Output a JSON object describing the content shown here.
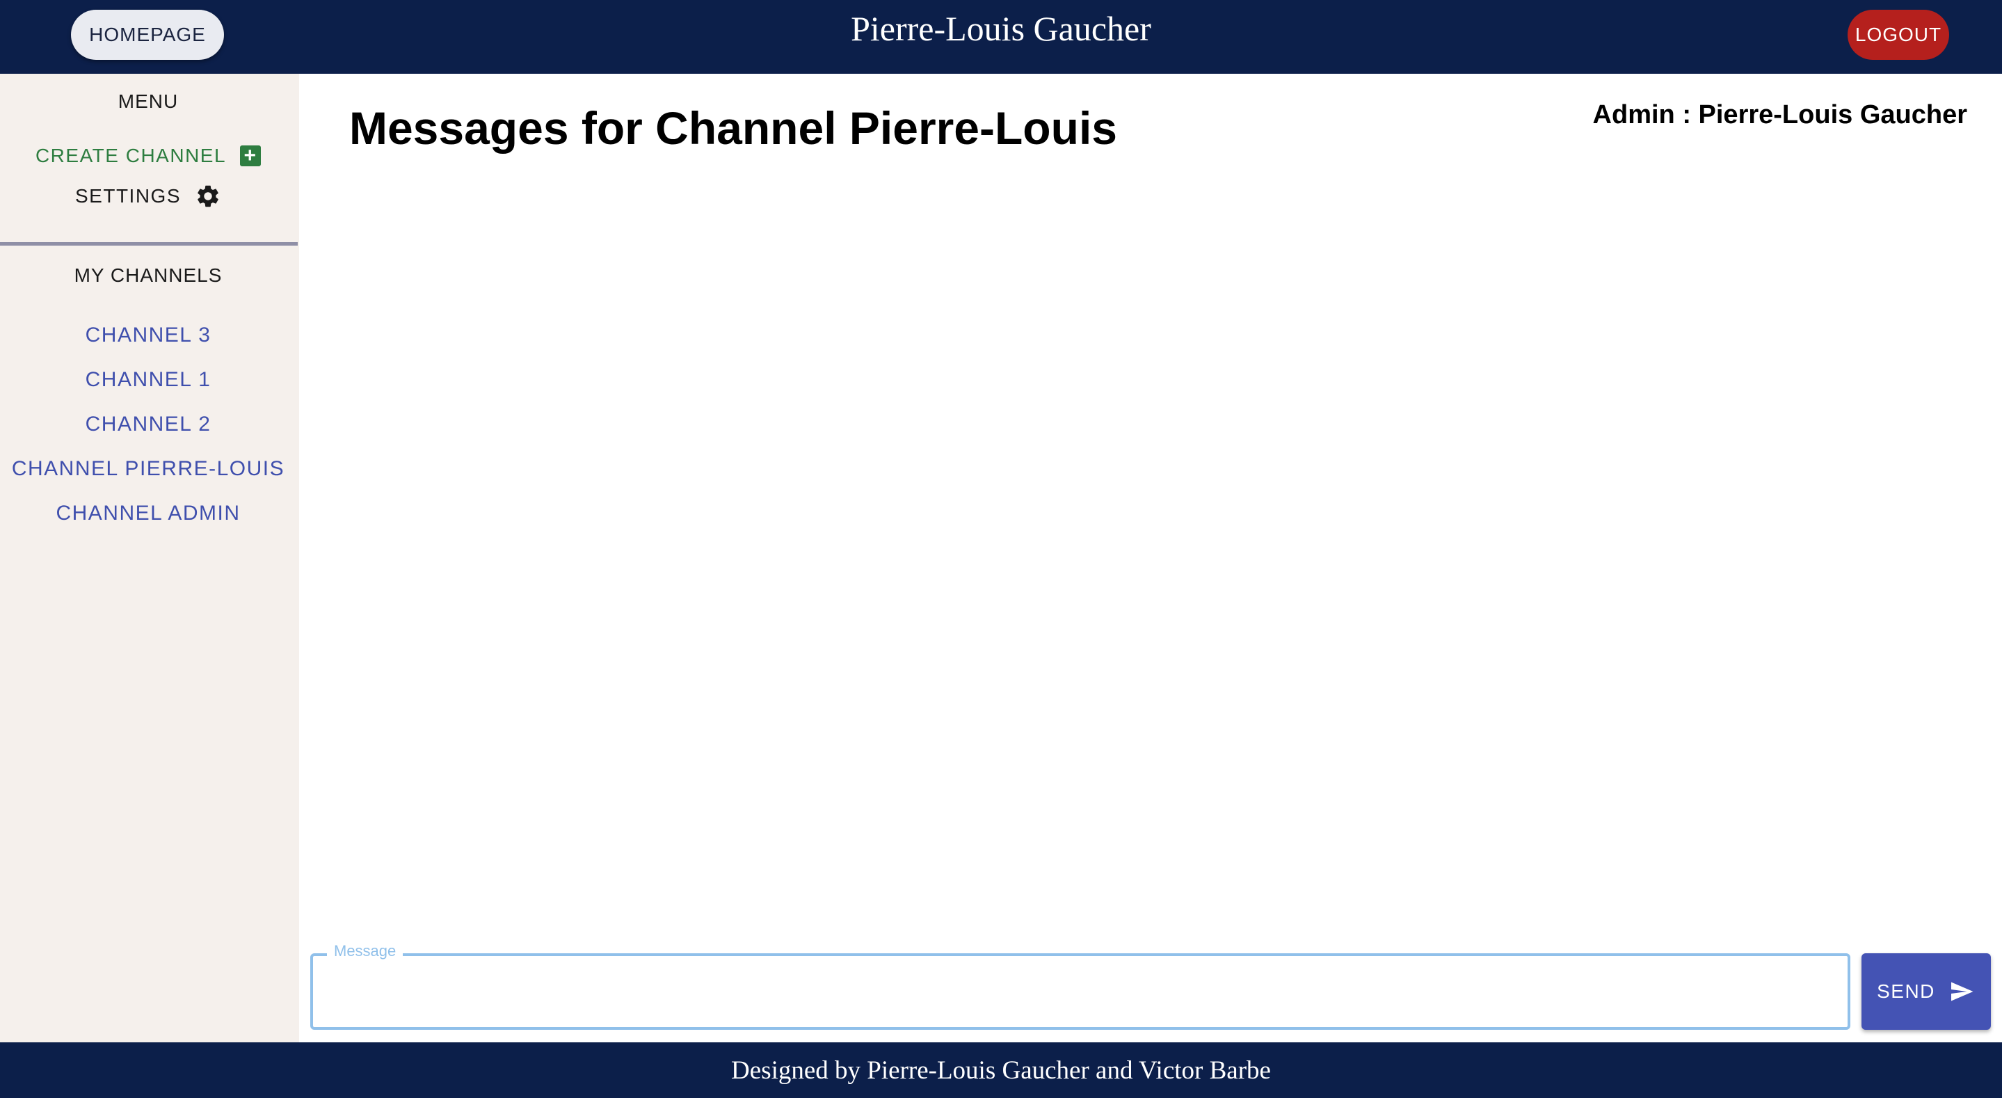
{
  "header": {
    "homepage_label": "HOMEPAGE",
    "title": "Pierre-Louis Gaucher",
    "logout_label": "LOGOUT"
  },
  "sidebar": {
    "menu_heading": "MENU",
    "create_channel_label": "CREATE CHANNEL",
    "settings_label": "SETTINGS",
    "channels_heading": "MY CHANNELS",
    "channels": [
      {
        "label": "CHANNEL 3"
      },
      {
        "label": "CHANNEL 1"
      },
      {
        "label": "CHANNEL 2"
      },
      {
        "label": "CHANNEL PIERRE-LOUIS"
      },
      {
        "label": "CHANNEL ADMIN"
      }
    ]
  },
  "main": {
    "title": "Messages for Channel Pierre-Louis",
    "admin_label": "Admin : Pierre-Louis Gaucher"
  },
  "composer": {
    "field_label": "Message",
    "value": "",
    "send_label": "SEND"
  },
  "footer": {
    "text": "Designed by Pierre-Louis Gaucher and Victor Barbe"
  },
  "colors": {
    "navbar": "#0c1f4a",
    "sidebar": "#f5f0ec",
    "accent": "#3f4fad",
    "create": "#2e7d40",
    "logout": "#b5201d"
  },
  "icons": {
    "create": "plus-box-icon",
    "settings": "gear-icon",
    "send": "send-icon"
  }
}
